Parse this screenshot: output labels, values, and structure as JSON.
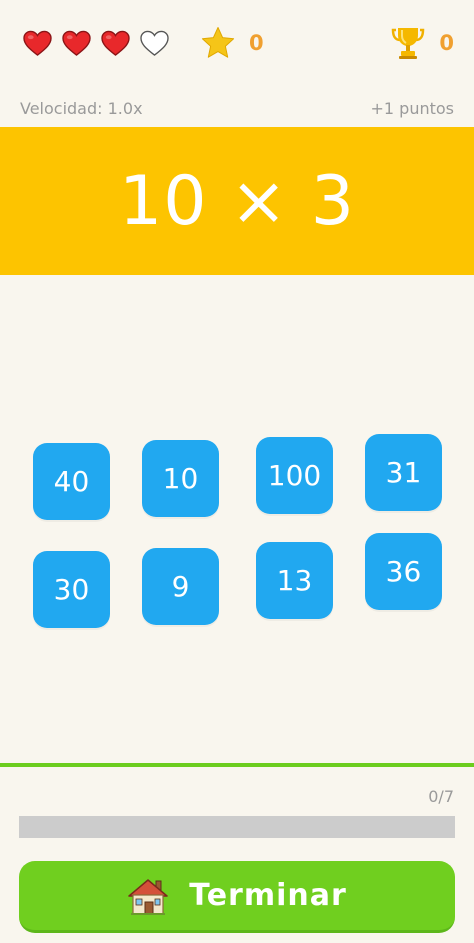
{
  "status": {
    "lives_total": 4,
    "lives_remaining": 3,
    "stars": "0",
    "trophies": "0"
  },
  "info": {
    "speed_label": "Velocidad: 1.0x",
    "points_label": "+1 puntos"
  },
  "question": {
    "text": "10 × 3",
    "banner_color": "#fdc400"
  },
  "answers": [
    {
      "value": "40"
    },
    {
      "value": "10"
    },
    {
      "value": "100"
    },
    {
      "value": "31"
    },
    {
      "value": "30"
    },
    {
      "value": "9"
    },
    {
      "value": "13"
    },
    {
      "value": "36"
    }
  ],
  "progress": {
    "label": "0/7",
    "fraction": 0
  },
  "finish_button": {
    "label": "Terminar",
    "icon": "house-icon"
  },
  "colors": {
    "tile": "#21a8f0",
    "accent_green": "#6ccd1e",
    "heart_red": "#e8282b",
    "star_gold": "#f5c518"
  }
}
